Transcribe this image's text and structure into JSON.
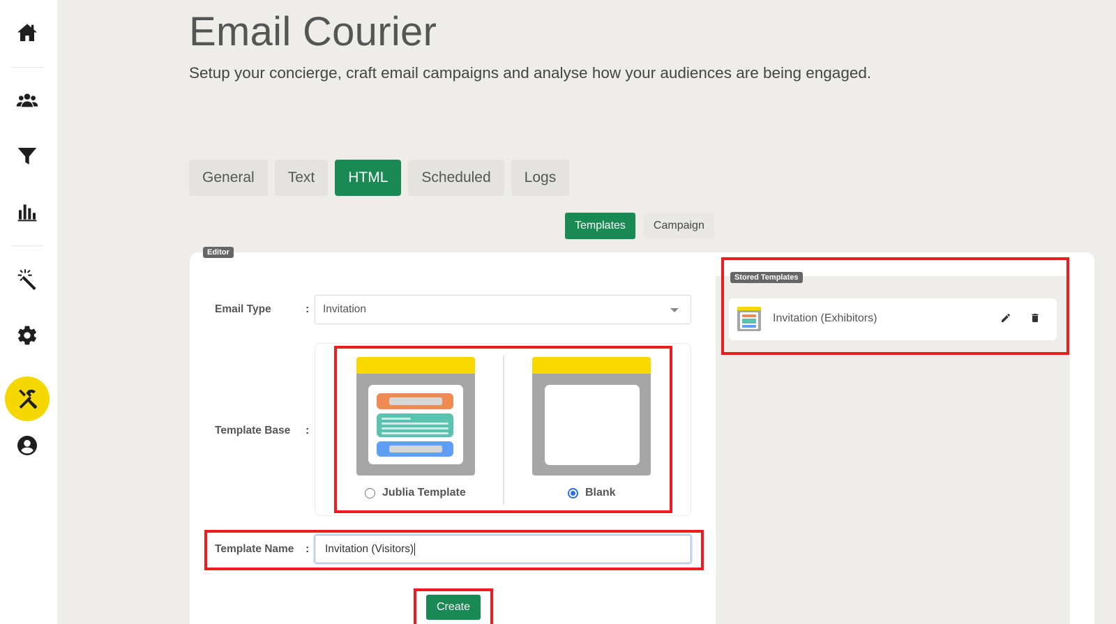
{
  "header": {
    "title": "Email Courier",
    "subtitle": "Setup your concierge, craft email campaigns and analyse how your audiences are being engaged."
  },
  "sidebar": {
    "items": [
      {
        "icon": "home-icon"
      },
      {
        "icon": "people-icon"
      },
      {
        "icon": "funnel-icon"
      },
      {
        "icon": "bar-chart-icon"
      },
      {
        "icon": "magic-wand-icon"
      },
      {
        "icon": "gear-icon"
      },
      {
        "icon": "tools-icon",
        "active": true
      },
      {
        "icon": "user-circle-icon"
      }
    ]
  },
  "tabs": [
    {
      "label": "General"
    },
    {
      "label": "Text"
    },
    {
      "label": "HTML",
      "active": true
    },
    {
      "label": "Scheduled"
    },
    {
      "label": "Logs"
    }
  ],
  "subtabs": [
    {
      "label": "Templates",
      "active": true
    },
    {
      "label": "Campaign"
    }
  ],
  "editor": {
    "badge": "Editor",
    "email_type": {
      "label": "Email Type",
      "colon": ":",
      "value": "Invitation"
    },
    "template_base": {
      "label": "Template Base",
      "colon": ":",
      "options": [
        {
          "label": "Jublia Template",
          "checked": false
        },
        {
          "label": "Blank",
          "checked": true
        }
      ]
    },
    "template_name": {
      "label": "Template Name",
      "colon": ":",
      "value": "Invitation (Visitors)"
    },
    "create_label": "Create"
  },
  "stored": {
    "badge": "Stored Templates",
    "items": [
      {
        "name": "Invitation (Exhibitors)",
        "icons": [
          "pencil-icon",
          "trash-icon"
        ]
      }
    ]
  },
  "colors": {
    "accent_green": "#1a8a55",
    "sidebar_active": "#f5d800",
    "highlight_red": "#ee1c1c"
  }
}
